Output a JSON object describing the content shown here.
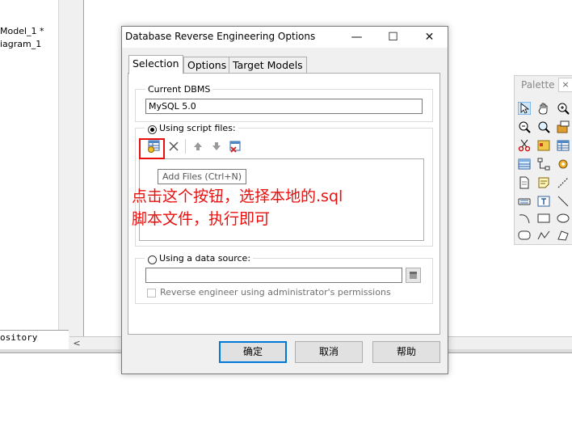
{
  "background_app": {
    "tree_items": [
      "Model_1 *",
      "iagram_1"
    ],
    "repository_tab": "ository",
    "hscroll_left_arrow": "<"
  },
  "palette": {
    "title": "Palette",
    "close_glyph": "×",
    "icons": [
      "pointer-icon",
      "hand-icon",
      "zoom-in-icon",
      "zoom-out-icon",
      "zoom-window-icon",
      "properties-icon",
      "cut-icon",
      "package-icon",
      "table-icon",
      "view-icon",
      "reference-icon",
      "procedure-icon",
      "file-icon",
      "note-icon",
      "link-icon",
      "text-icon",
      "title-box-icon",
      "line-icon",
      "arc-icon",
      "rectangle-icon",
      "ellipse-icon",
      "rounded-rect-icon",
      "polyline-icon",
      "polygon-icon"
    ]
  },
  "dialog": {
    "title": "Database Reverse Engineering Options",
    "titlebar_buttons": {
      "minimize": "—",
      "maximize": "☐",
      "close": "✕"
    },
    "tabs": [
      {
        "label": "Selection",
        "active": true
      },
      {
        "label": "Options",
        "active": false
      },
      {
        "label": "Target Models",
        "active": false
      }
    ],
    "current_dbms": {
      "label": "Current DBMS",
      "value": "MySQL 5.0"
    },
    "script_files": {
      "label": "Using script files:",
      "selected": true,
      "toolbar": [
        "add-files-icon",
        "delete-icon",
        "move-up-icon",
        "move-down-icon",
        "clear-all-icon"
      ],
      "tooltip": "Add Files (Ctrl+N)"
    },
    "annotation": {
      "line1": "点击这个按钮，选择本地的.sql",
      "line2": "脚本文件，执行即可",
      "color": "#e8100f"
    },
    "data_source": {
      "label": "Using a data source:",
      "selected": false,
      "value": "",
      "admin_checkbox_label": "Reverse engineer using administrator's permissions",
      "admin_checked": false
    },
    "buttons": {
      "ok": "确定",
      "cancel": "取消",
      "help": "帮助"
    }
  }
}
